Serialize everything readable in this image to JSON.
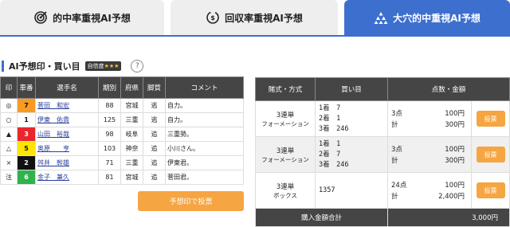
{
  "tabs": [
    {
      "label": "的中率重視AI予想",
      "icon": "target-icon"
    },
    {
      "label": "回収率重視AI予想",
      "icon": "money-cycle-icon"
    },
    {
      "label": "大穴的中重視AI予想",
      "icon": "pyramid-icon"
    }
  ],
  "section": {
    "title": "AI予想印・買い目",
    "confidence_label": "自信度",
    "confidence_stars": "★★★",
    "help": "?"
  },
  "left_table": {
    "headers": [
      "印",
      "車番",
      "選手名",
      "期別",
      "府県",
      "脚質",
      "コメント"
    ],
    "rows": [
      {
        "mark": "◎",
        "num": "7",
        "num_bg": "#f79b22",
        "num_fg": "#111111",
        "name": "菅田　和宏",
        "term": "88",
        "pref": "宮城",
        "style": "逃",
        "comment": "自力。"
      },
      {
        "mark": "○",
        "num": "1",
        "num_bg": "#ffffff",
        "num_fg": "#111111",
        "name": "伊東　佑貴",
        "term": "125",
        "pref": "三重",
        "style": "逃",
        "comment": "自力。"
      },
      {
        "mark": "▲",
        "num": "3",
        "num_bg": "#e8262b",
        "num_fg": "#ffffff",
        "name": "山田　裕哉",
        "term": "98",
        "pref": "岐阜",
        "style": "追",
        "comment": "三重勢。"
      },
      {
        "mark": "△",
        "num": "5",
        "num_bg": "#ffe600",
        "num_fg": "#111111",
        "name": "奥原　　亨",
        "term": "103",
        "pref": "神奈",
        "style": "追",
        "comment": "小川さん。"
      },
      {
        "mark": "×",
        "num": "2",
        "num_bg": "#111111",
        "num_fg": "#ffffff",
        "name": "舛井　幹雄",
        "term": "71",
        "pref": "三重",
        "style": "追",
        "comment": "伊東君。"
      },
      {
        "mark": "注",
        "num": "6",
        "num_bg": "#2fb34a",
        "num_fg": "#ffffff",
        "name": "金子　兼久",
        "term": "81",
        "pref": "宮城",
        "style": "追",
        "comment": "菅田君。"
      }
    ],
    "button": "予想印で投票"
  },
  "right_table": {
    "headers": [
      "賭式・方式",
      "買い目",
      "点数・金額"
    ],
    "rows": [
      {
        "kind": "3連単",
        "method": "フォーメーション",
        "lines": [
          "1着　7",
          "2着　1",
          "3着　246"
        ],
        "points": "3点",
        "unit": "100円",
        "total_label": "計",
        "total": "300円",
        "button": "投票"
      },
      {
        "kind": "3連単",
        "method": "フォーメーション",
        "lines": [
          "1着　1",
          "2着　7",
          "3着　246"
        ],
        "points": "3点",
        "unit": "100円",
        "total_label": "計",
        "total": "300円",
        "button": "投票"
      },
      {
        "kind": "3連単",
        "method": "ボックス",
        "lines": [
          "1357"
        ],
        "points": "24点",
        "unit": "100円",
        "total_label": "計",
        "total": "2,400円",
        "button": "投票"
      }
    ],
    "total_label": "購入金額合計",
    "total_value": "3,000円"
  }
}
